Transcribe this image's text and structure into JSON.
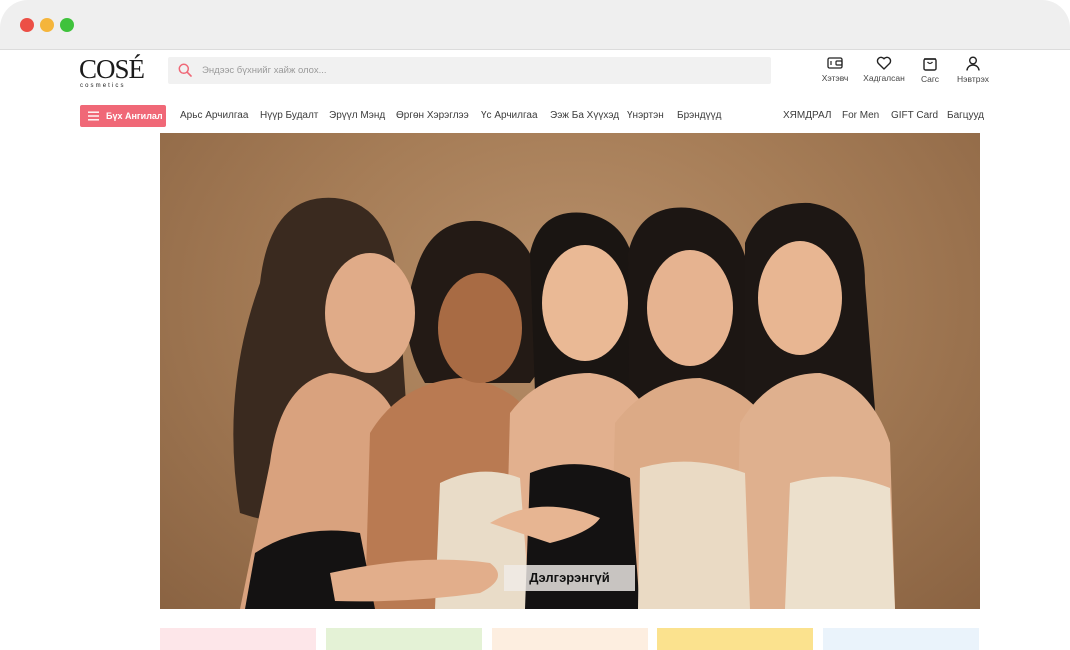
{
  "header": {
    "logo_text": "COSÉ",
    "logo_sub": "cosmetics",
    "search_placeholder": "Эндээс бүхнийг хайж олох...",
    "actions": [
      {
        "icon": "wallet-icon",
        "label": "Хэтэвч"
      },
      {
        "icon": "heart-icon",
        "label": "Хадгалсан"
      },
      {
        "icon": "bag-icon",
        "label": "Сагс"
      },
      {
        "icon": "user-icon",
        "label": "Нэвтрэх"
      }
    ]
  },
  "nav": {
    "all_categories": "Бүх Ангилал",
    "left_links": [
      "Арьс Арчилгаа",
      "Нүүр Будалт",
      "Эрүүл Мэнд",
      "Өргөн Хэрэглээ",
      "Үс Арчилгаа",
      "Ээж Ба Хүүхэд",
      "Үнэртэн",
      "Брэндүүд"
    ],
    "right_links": [
      "ХЯМДРАЛ",
      "For Men",
      "GIFT Card",
      "Багцууд"
    ]
  },
  "hero": {
    "cta": "Дэлгэрэнгүй"
  },
  "colors": {
    "accent": "#f06877",
    "chrome": "#efefef",
    "hero_bg": "#a67d57"
  },
  "category_cards": [
    {
      "color": "#fde6e9"
    },
    {
      "color": "#e4f2d6"
    },
    {
      "color": "#fdeee0"
    },
    {
      "color": "#fbe28e"
    },
    {
      "color": "#eaf3fb"
    }
  ]
}
